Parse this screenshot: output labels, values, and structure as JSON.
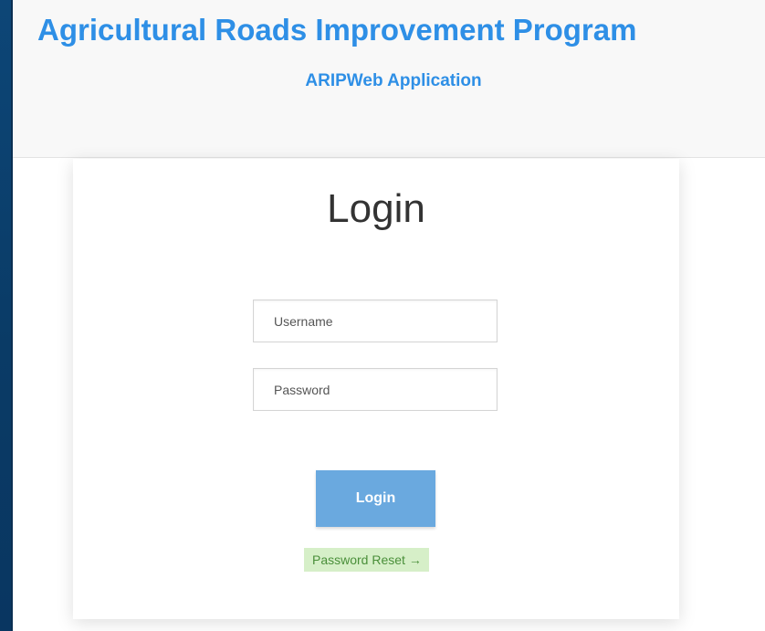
{
  "header": {
    "title": "Agricultural Roads Improvement Program",
    "subtitle": "ARIPWeb Application"
  },
  "login": {
    "heading": "Login",
    "username": {
      "placeholder": "Username",
      "value": ""
    },
    "password": {
      "placeholder": "Password",
      "value": ""
    },
    "submit_label": "Login",
    "reset_label": "Password Reset →"
  },
  "colors": {
    "frame": "#0b3f6e",
    "brand_blue": "#2e8fe6",
    "button": "#6aa9df",
    "reset_bg": "#d6efc8",
    "reset_text": "#4a8f3a"
  }
}
